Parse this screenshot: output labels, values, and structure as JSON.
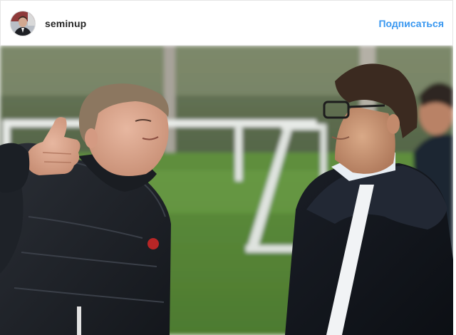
{
  "post": {
    "username": "seminup",
    "follow_label": "Подписаться",
    "avatar_icon": "profile-photo-icon",
    "photo_icon": "post-photo"
  },
  "colors": {
    "link_blue": "#3897f0",
    "text_dark": "#262626",
    "border": "#e6e6e6"
  }
}
